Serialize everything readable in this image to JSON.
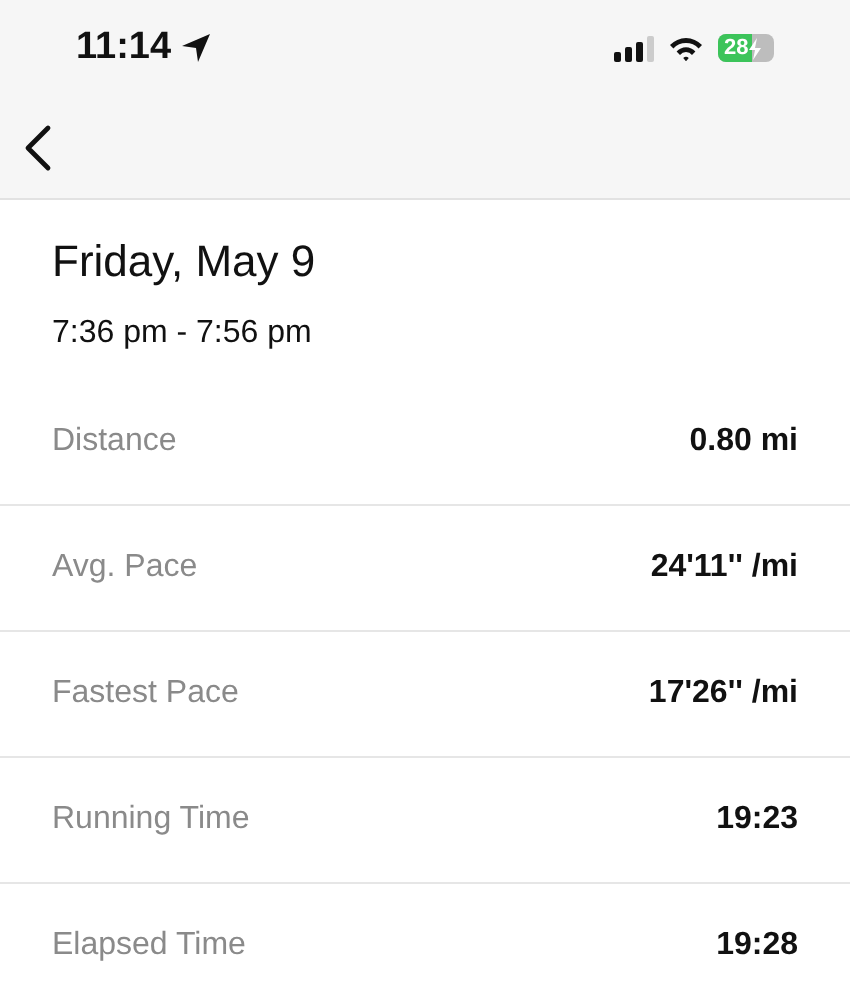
{
  "status_bar": {
    "time": "11:14",
    "battery": "28",
    "charging": true
  },
  "header": {
    "title": "Friday, May 9",
    "time_range": "7:36 pm - 7:56 pm"
  },
  "stats": [
    {
      "label": "Distance",
      "value": "0.80 mi"
    },
    {
      "label": "Avg. Pace",
      "value": "24'11'' /mi"
    },
    {
      "label": "Fastest Pace",
      "value": "17'26'' /mi"
    },
    {
      "label": "Running Time",
      "value": "19:23"
    },
    {
      "label": "Elapsed Time",
      "value": "19:28"
    }
  ]
}
